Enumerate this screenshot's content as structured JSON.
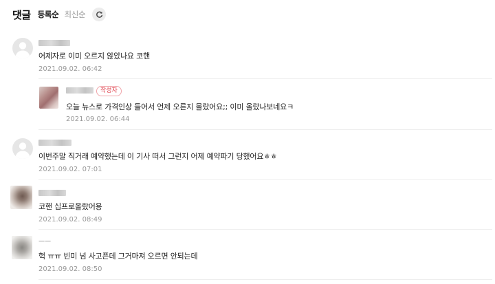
{
  "header": {
    "title": "댓글",
    "sort_options": [
      "등록순",
      "최신순"
    ],
    "refresh_icon": "refresh-icon"
  },
  "comments": [
    {
      "text": "어제자로 이미 오르지 않았나요 코핸",
      "date": "2021.09.02. 06:42"
    },
    {
      "badge": "작성자",
      "text": "오늘 뉴스로 가격인상 들어서 언제 오른지 몰랐어요;; 이미 올랐나보네요ㅋ",
      "date": "2021.09.02. 06:44"
    },
    {
      "text": "이번주말 직거래 예약했는데 이 기사 떠서 그런지 어제 예약파기 당했어요ㅎㅎ",
      "date": "2021.09.02. 07:01"
    },
    {
      "text": "코핸 십프로올랐어용",
      "date": "2021.09.02. 08:49"
    },
    {
      "nickname": "ㅡㅡ",
      "text": "헉 ㅠㅠ 빈미 넘 사고픈데 그거마져 오르면 안되는데",
      "date": "2021.09.02. 08:50"
    }
  ]
}
